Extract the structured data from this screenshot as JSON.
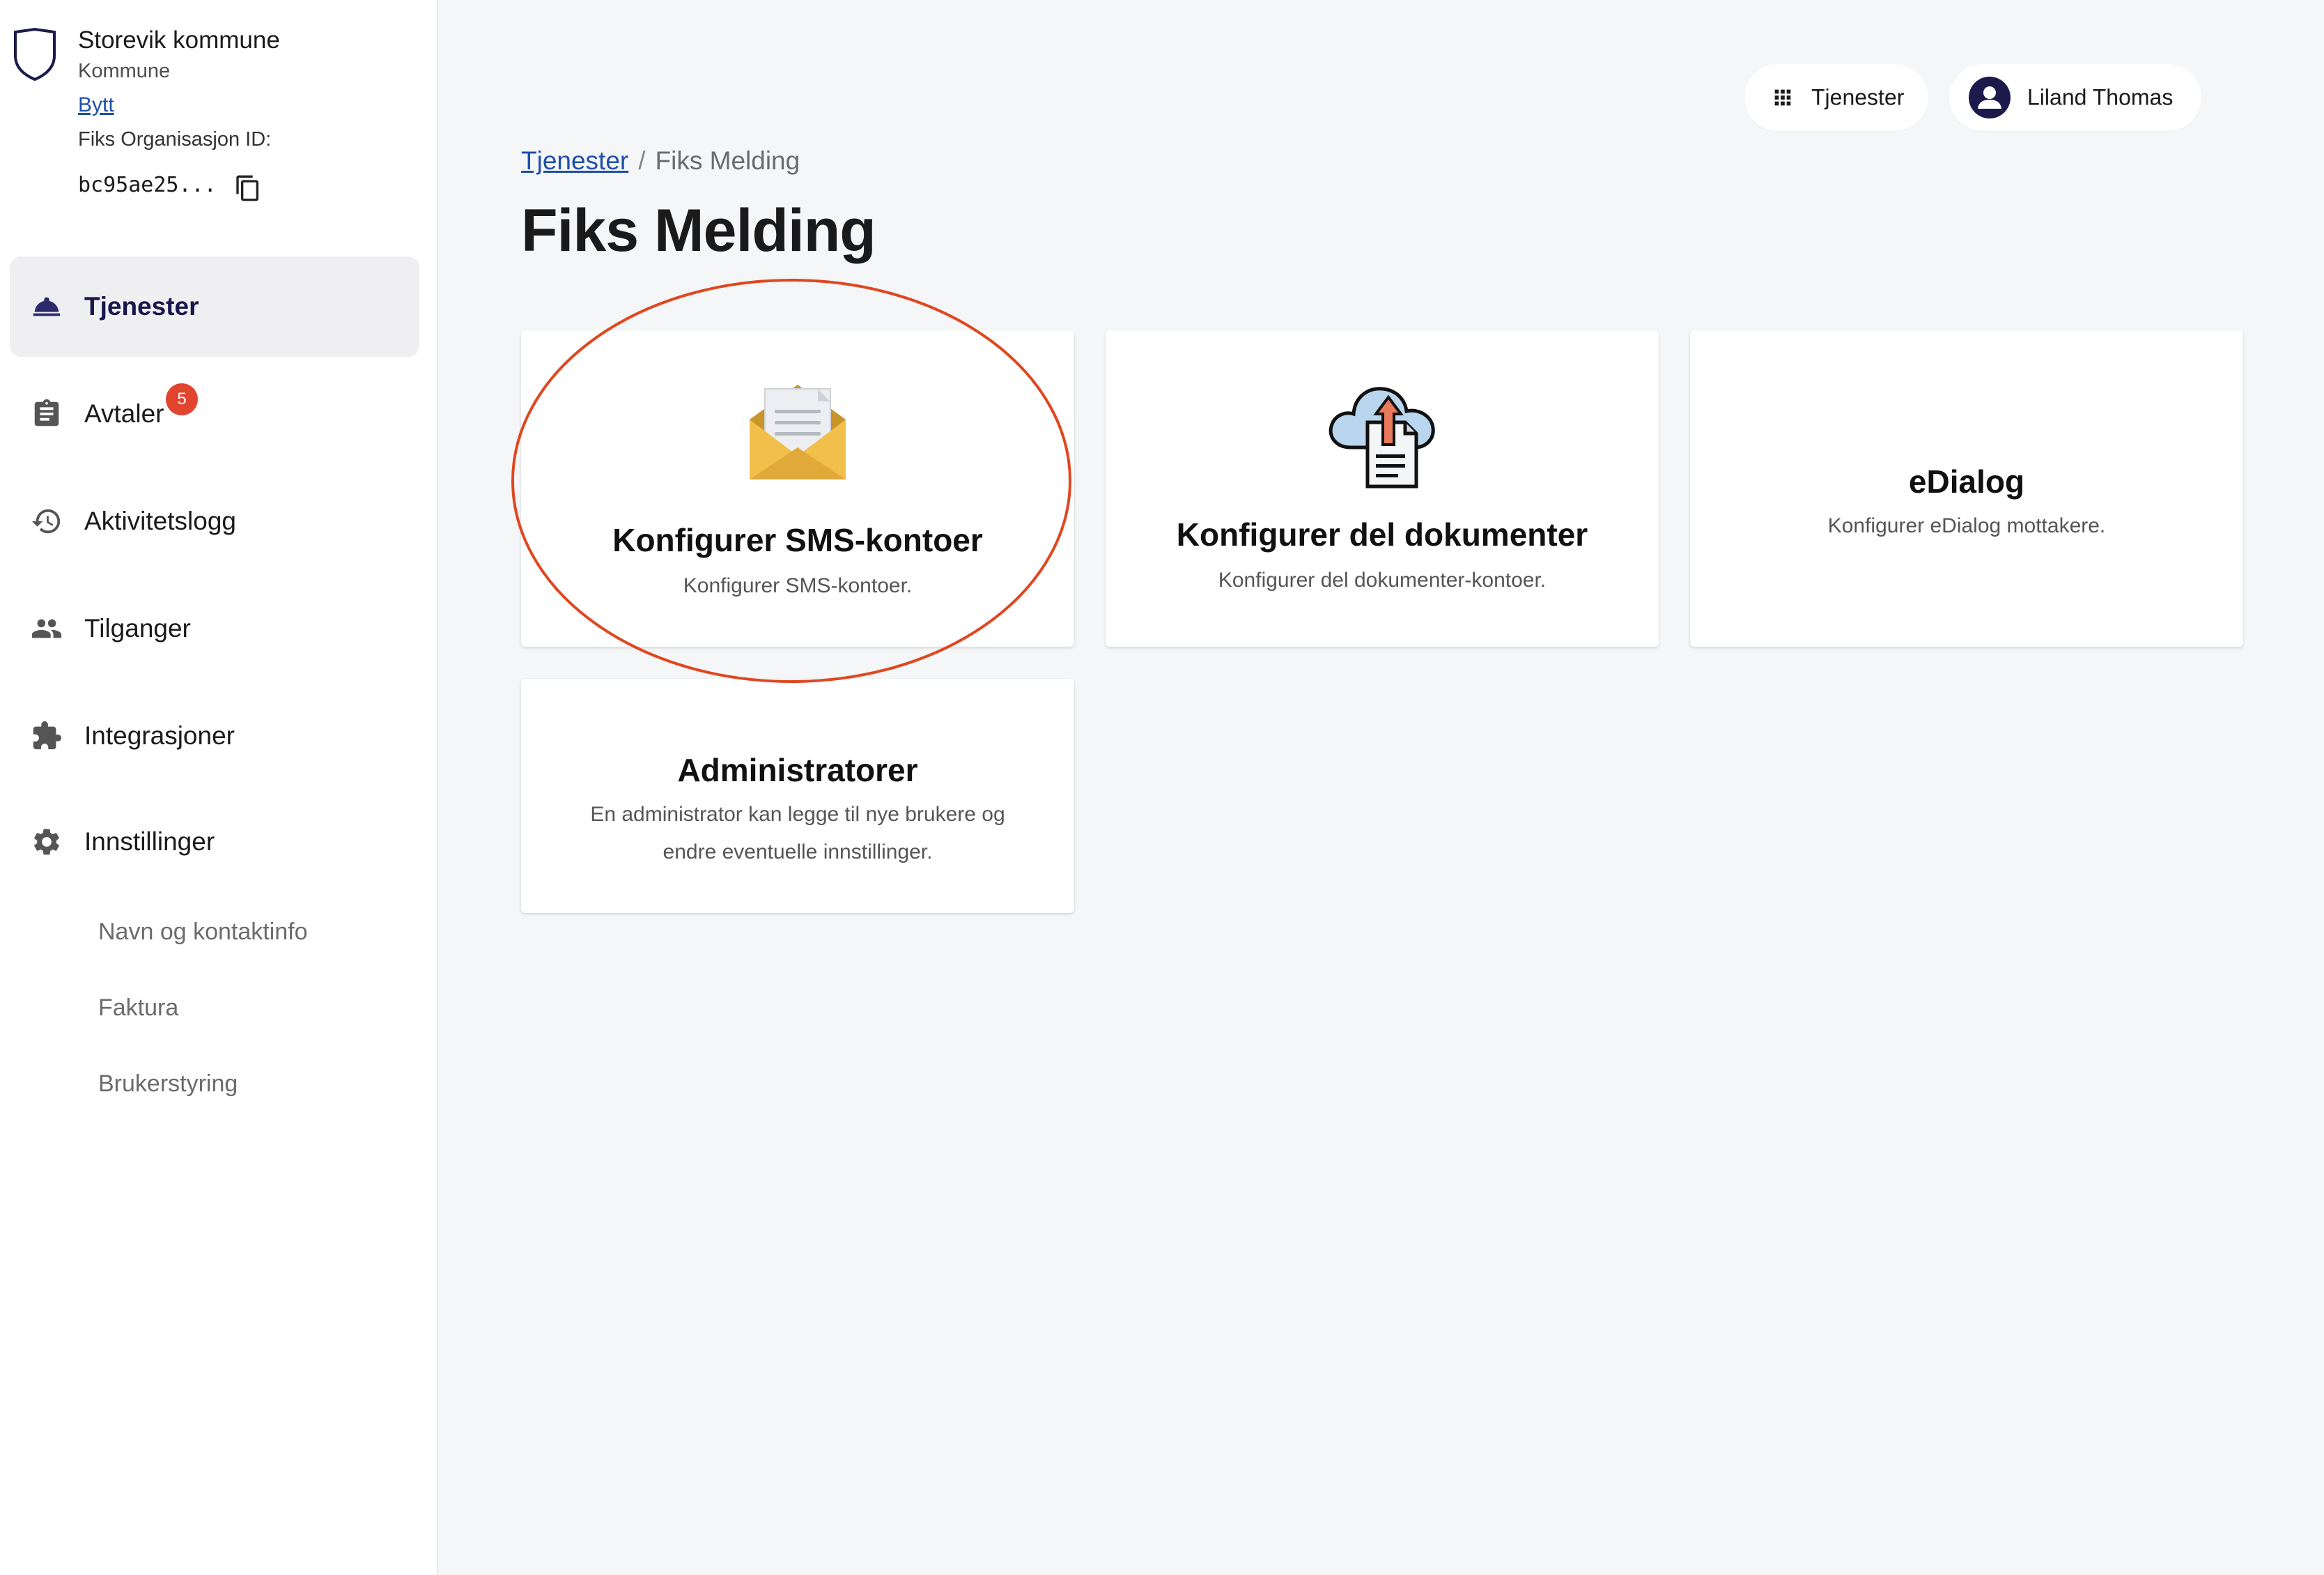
{
  "org": {
    "name": "Storevik kommune",
    "type": "Kommune",
    "switch_label": "Bytt",
    "id_label": "Fiks Organisasjon ID:",
    "id_value": "bc95ae25..."
  },
  "sidebar": {
    "items": [
      {
        "label": "Tjenester",
        "icon": "service-bell-icon",
        "active": true
      },
      {
        "label": "Avtaler",
        "icon": "clipboard-icon",
        "badge": "5"
      },
      {
        "label": "Aktivitetslogg",
        "icon": "history-icon"
      },
      {
        "label": "Tilganger",
        "icon": "people-icon"
      },
      {
        "label": "Integrasjoner",
        "icon": "puzzle-icon"
      },
      {
        "label": "Innstillinger",
        "icon": "gear-icon"
      }
    ],
    "sub_items": [
      "Navn og kontaktinfo",
      "Faktura",
      "Brukerstyring"
    ]
  },
  "header": {
    "services_label": "Tjenester",
    "user_name": "Liland Thomas"
  },
  "breadcrumb": {
    "link": "Tjenester",
    "separator": "/",
    "current": "Fiks Melding"
  },
  "page": {
    "title": "Fiks Melding"
  },
  "cards": [
    {
      "title": "Konfigurer SMS-kontoer",
      "description": "Konfigurer SMS-kontoer.",
      "icon": "envelope-icon",
      "highlighted": true
    },
    {
      "title": "Konfigurer del dokumenter",
      "description": "Konfigurer del dokumenter-kontoer.",
      "icon": "cloud-upload-document-icon"
    },
    {
      "title": "eDialog",
      "description": "Konfigurer eDialog mottakere."
    },
    {
      "title": "Administratorer",
      "description": "En administrator kan legge til nye brukere og endre eventuelle innstillinger."
    }
  ],
  "colors": {
    "accent": "#18164a",
    "link": "#1f4fa8",
    "badge": "#e1442f",
    "highlight": "#e0471f",
    "background": "#f5f6f8"
  }
}
